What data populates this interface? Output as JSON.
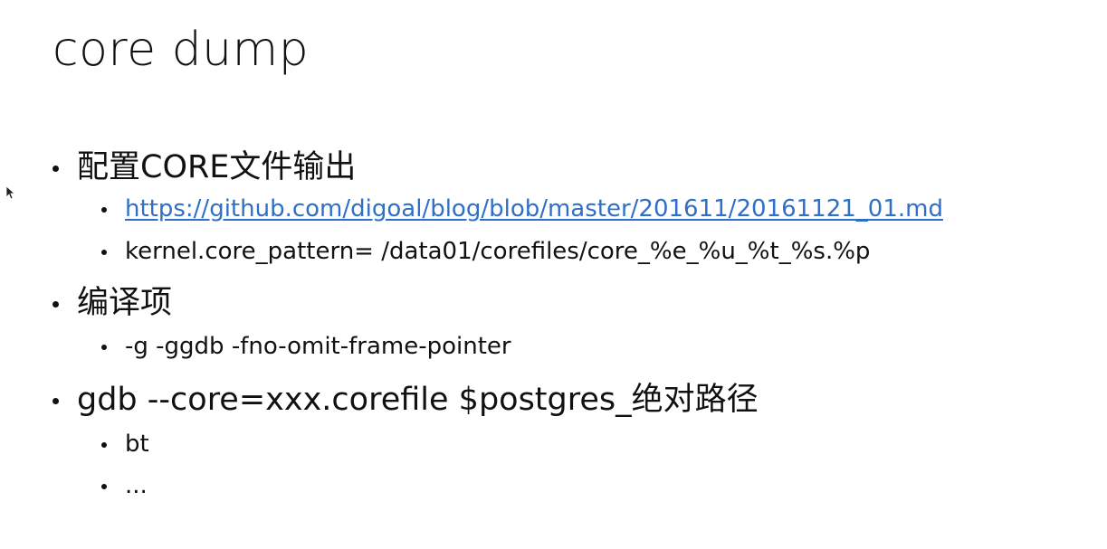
{
  "slide": {
    "title": "core dump",
    "bullets": [
      {
        "text": "配置CORE文件输出",
        "children": [
          {
            "text": "https://github.com/digoal/blog/blob/master/201611/20161121_01.md",
            "link": true
          },
          {
            "text": "kernel.core_pattern= /data01/corefiles/core_%e_%u_%t_%s.%p"
          }
        ]
      },
      {
        "text": "编译项",
        "children": [
          {
            "text": "-g -ggdb -fno-omit-frame-pointer"
          }
        ]
      },
      {
        "text": "gdb --core=xxx.corefile $postgres_绝对路径",
        "children": [
          {
            "text": "bt"
          },
          {
            "text": "..."
          }
        ]
      }
    ]
  },
  "colors": {
    "link": "#2f6fc8",
    "text": "#111111",
    "background": "#ffffff"
  },
  "icons": {
    "cursor": "mouse-pointer-icon"
  }
}
